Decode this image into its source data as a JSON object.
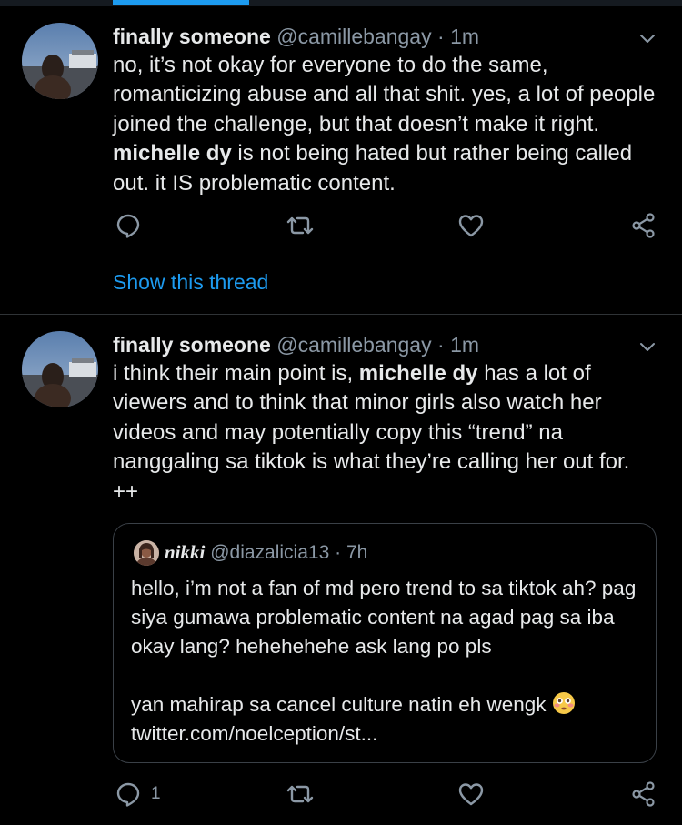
{
  "tweets": [
    {
      "name": "finally someone",
      "handle": "@camillebangay",
      "dot": "·",
      "time": "1m",
      "text_before": "no, it’s not okay for everyone to do the same, romanticizing abuse and all that shit. yes, a lot of people joined the challenge, but that doesn’t make it right. ",
      "text_bold": "michelle dy",
      "text_after": " is not being hated but rather being called out. it IS problematic content.",
      "show_thread": "Show this thread"
    },
    {
      "name": "finally someone",
      "handle": "@camillebangay",
      "dot": "·",
      "time": "1m",
      "text_before": "i think their main point is, ",
      "text_bold": "michelle dy",
      "text_after": " has a lot of viewers and to think that minor girls also watch her videos and may potentially copy this “trend” na nanggaling sa tiktok is what they’re calling her out for. ++",
      "reply_count": "1",
      "quote": {
        "name": "nikki",
        "handle": "@diazalicia13",
        "dot": "·",
        "time": "7h",
        "line1": "hello, i’m not a fan of md pero trend to sa tiktok ah? pag siya gumawa problematic content na agad pag sa iba okay lang? hehehehehe ask lang po pls",
        "line2": "yan mahirap sa cancel culture natin eh wengk",
        "emoji": "flushed-face-emoji",
        "link": "twitter.com/noelception/st..."
      }
    }
  ],
  "icons": {
    "reply": "reply-icon",
    "retweet": "retweet-icon",
    "like": "like-icon",
    "share": "share-icon",
    "menu": "chevron-down-icon"
  },
  "colors": {
    "background": "#000000",
    "accent": "#1d9bf0",
    "muted": "#8b98a5",
    "text": "#e7e9ea",
    "divider": "#2f3336"
  }
}
